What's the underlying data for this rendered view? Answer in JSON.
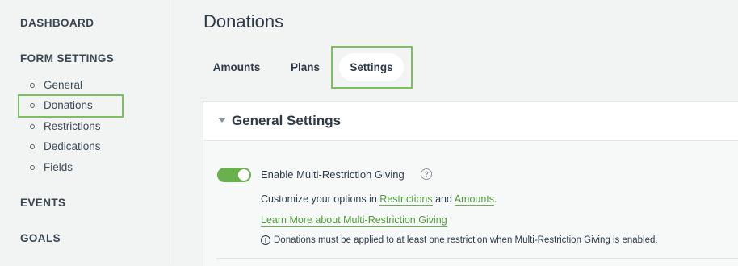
{
  "sidebar": {
    "dashboard": "DASHBOARD",
    "form_settings": "FORM SETTINGS",
    "sub_items": [
      "General",
      "Donations",
      "Restrictions",
      "Dedications",
      "Fields"
    ],
    "events": "EVENTS",
    "goals": "GOALS"
  },
  "page": {
    "title": "Donations"
  },
  "tabs": [
    "Amounts",
    "Plans",
    "Settings"
  ],
  "panel": {
    "title": "General Settings",
    "toggle": {
      "label": "Enable Multi-Restriction Giving",
      "state": "on",
      "help_icon": "?"
    },
    "desc_prefix": "Customize your options in ",
    "desc_link1": "Restrictions",
    "desc_and": " and ",
    "desc_link2": "Amounts",
    "desc_suffix": ".",
    "learn_more": "Learn More about Multi-Restriction Giving",
    "info_icon": "i",
    "notice": "Donations must be applied to at least one restriction when Multi-Restriction Giving is enabled."
  },
  "colors": {
    "accent": "#6ab04c",
    "highlight": "#7bbf5e",
    "text": "#2e3a47"
  }
}
